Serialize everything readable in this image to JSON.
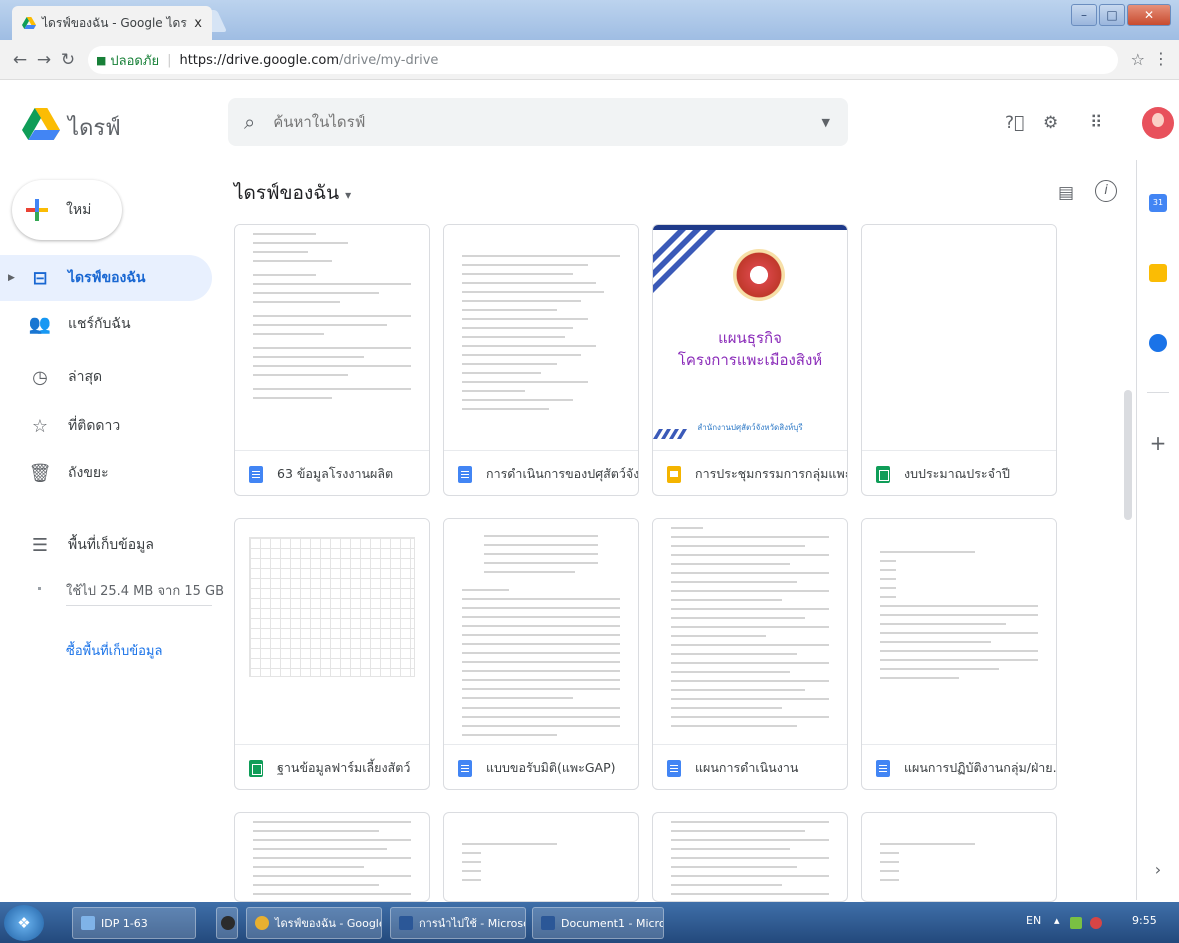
{
  "browser": {
    "tab_title": "ไดรฟ์ของฉัน - Google ไดร",
    "tab_close": "x",
    "secure_label": "ปลอดภัย",
    "url_host": "https://drive.google.com",
    "url_path": "/drive/my-drive"
  },
  "header": {
    "app_title": "ไดรฟ์",
    "search_placeholder": "ค้นหาในไดรฟ์"
  },
  "sidebar": {
    "new_label": "ใหม่",
    "items": [
      {
        "label": "ไดรฟ์ของฉัน",
        "icon": "my-drive-icon",
        "active": true
      },
      {
        "label": "แชร์กับฉัน",
        "icon": "shared-icon"
      },
      {
        "label": "ล่าสุด",
        "icon": "recent-icon"
      },
      {
        "label": "ที่ติดดาว",
        "icon": "star-icon"
      },
      {
        "label": "ถังขยะ",
        "icon": "trash-icon"
      }
    ],
    "storage_label": "พื้นที่เก็บข้อมูล",
    "storage_used": "ใช้ไป 25.4 MB จาก 15 GB",
    "buy_storage": "ซื้อพื้นที่เก็บข้อมูล"
  },
  "main": {
    "breadcrumb": "ไดรฟ์ของฉัน",
    "files": [
      {
        "name": "63 ข้อมูลโรงงานผลิต",
        "type": "doc"
      },
      {
        "name": "การดำเนินการของปศุสัตว์จัง...",
        "type": "doc"
      },
      {
        "name": "การประชุมกรรมการกลุ่มแพะ...",
        "type": "slide",
        "slide_title_1": "แผนธุรกิจ",
        "slide_title_2": "โครงการแพะเมืองสิงห์",
        "slide_sub": "สำนักงานปศุสัตว์จังหวัดสิงห์บุรี"
      },
      {
        "name": "งบประมาณประจำปี",
        "type": "sheet"
      },
      {
        "name": "ฐานข้อมูลฟาร์มเลี้ยงสัตว์",
        "type": "sheet"
      },
      {
        "name": "แบบขอรับมิติ(แพะGAP)",
        "type": "doc"
      },
      {
        "name": "แผนการดำเนินงาน",
        "type": "doc"
      },
      {
        "name": "แผนการปฏิบัติงานกลุ่ม/ฝ่าย...",
        "type": "doc"
      }
    ]
  },
  "side_panel": {
    "calendar_label": "31"
  },
  "taskbar": {
    "items": [
      "IDP 1-63",
      "ไดรฟ์ของฉัน - Google...",
      "การนำไปใช้ - Microso...",
      "Document1 - Micros..."
    ],
    "lang": "EN",
    "time": "9:55"
  },
  "colors": {
    "accent_blue": "#1a73e8",
    "active_bg": "#e8f0fe",
    "doc_blue": "#4285f4",
    "sheet_green": "#0f9d58",
    "slide_yellow": "#f4b400"
  }
}
